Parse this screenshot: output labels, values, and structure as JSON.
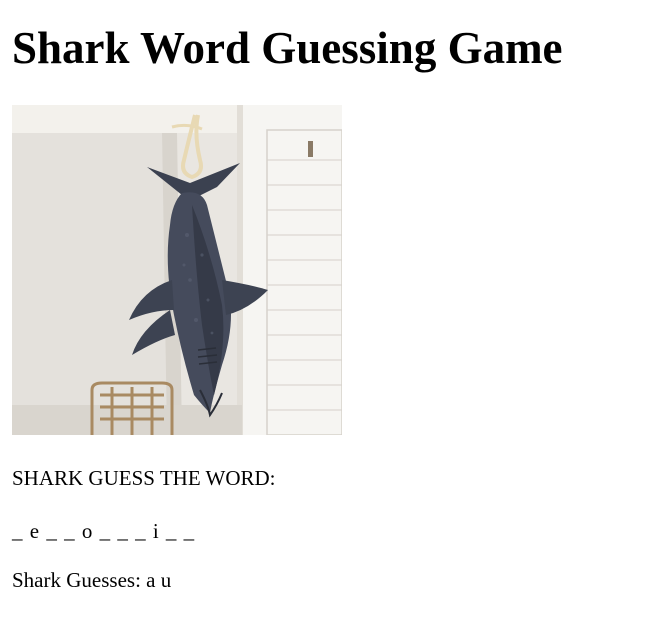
{
  "page": {
    "title": "Shark Word Guessing Game"
  },
  "image": {
    "icon": "hanging-shark-photo"
  },
  "game": {
    "prompt": "SHARK GUESS THE WORD:",
    "word_display": "_ e _ _ o _ _ _ i _ _",
    "guesses_label": "Shark Guesses: a u"
  }
}
